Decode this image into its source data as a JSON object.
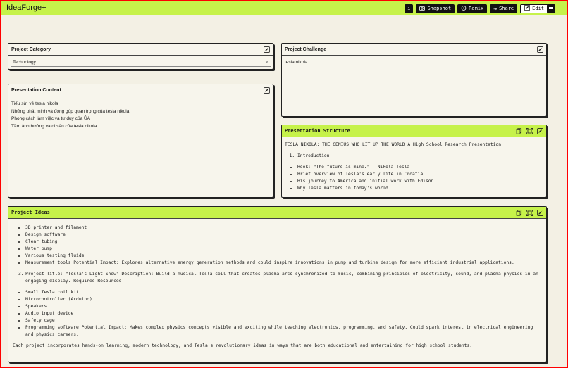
{
  "app": {
    "brand": "IdeaForge+",
    "cut_text": "                                                                                                    ",
    "toolbar": {
      "info": "i",
      "snapshot": "Snapshot",
      "remix": "Remix",
      "share": "Share",
      "edit": "Edit"
    }
  },
  "category": {
    "title": "Project Category",
    "value": "Technology",
    "clear": "×"
  },
  "challenge": {
    "title": "Project Challenge",
    "value": "tesla nikola"
  },
  "content": {
    "title": "Presentation Content",
    "lines": [
      "Tiểu sử: về tesla nikola",
      "Những phát minh và đóng góp quan trọng của tesla nikola",
      "Phong cách làm việc và tư duy của ỦA",
      "Tầm ảnh hưởng và di sản của tesla nikola"
    ]
  },
  "structure": {
    "title": "Presentation Structure",
    "heading": "TESLA NIKOLA: THE GENIUS WHO LIT UP THE WORLD A High School Research Presentation",
    "section": "Introduction",
    "bullets": [
      "Hook: \"The future is mine.\" - Nikola Tesla",
      "Brief overview of Tesla's early life in Croatia",
      "His journey to America and initial work with Edison",
      "Why Tesla matters in today's world"
    ]
  },
  "ideas": {
    "title": "Project Ideas",
    "list1": [
      "3D printer and filament",
      "Design software",
      "Clear tubing",
      "Water pump",
      "Various testing fluids",
      "Measurement tools Potential Impact: Explores alternative energy generation methods and could inspire innovations in pump and turbine design for more efficient industrial applications."
    ],
    "item3_num": "3.",
    "item3": "Project Title: \"Tesla's Light Show\" Description: Build a musical Tesla coil that creates plasma arcs synchronized to music, combining principles of electricity, sound, and plasma physics in an engaging display. Required Resources:",
    "list2": [
      "Small Tesla coil kit",
      "Microcontroller (Arduino)",
      "Speakers",
      "Audio input device",
      "Safety cage",
      "Programming software Potential Impact: Makes complex physics concepts visible and exciting while teaching electronics, programming, and safety. Could spark interest in electrical engineering and physics careers."
    ],
    "closing": "Each project incorporates hands-on learning, modern technology, and Tesla's revolutionary ideas in ways that are both educational and entertaining for high school students."
  }
}
